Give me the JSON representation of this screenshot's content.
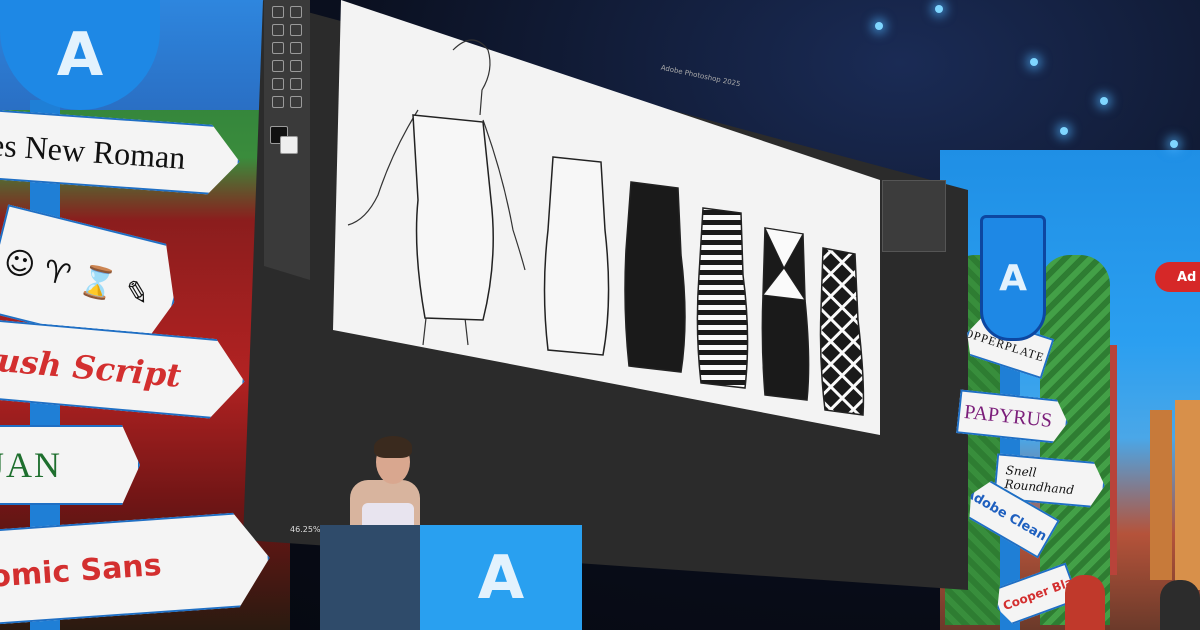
{
  "backdrop": {
    "left_signs": {
      "roman": "es New Roman",
      "brush": "rush Script",
      "jan": "JAN",
      "comic": "omic Sans"
    },
    "right_signs": {
      "copperplate": "COPPERPLATE",
      "papyrus": "PAPYRUS",
      "snell_line1": "Snell",
      "snell_line2": "Roundhand",
      "adobe_clean": "Adobe Clean",
      "cooper": "Cooper Bla"
    },
    "plane_text": "Ad",
    "logo_letter": "A"
  },
  "screen": {
    "app_title": "Adobe Photoshop 2025",
    "zoom_level": "46.25%"
  },
  "artwork": {
    "dress_styles": [
      "outline",
      "blank",
      "solid",
      "striped",
      "harlequin",
      "lattice"
    ]
  },
  "colors": {
    "adobe_blue": "#1e88e5",
    "sign_red": "#d32f2f",
    "sign_green": "#1e6f2e",
    "screen_dark": "#2b2b2b"
  }
}
